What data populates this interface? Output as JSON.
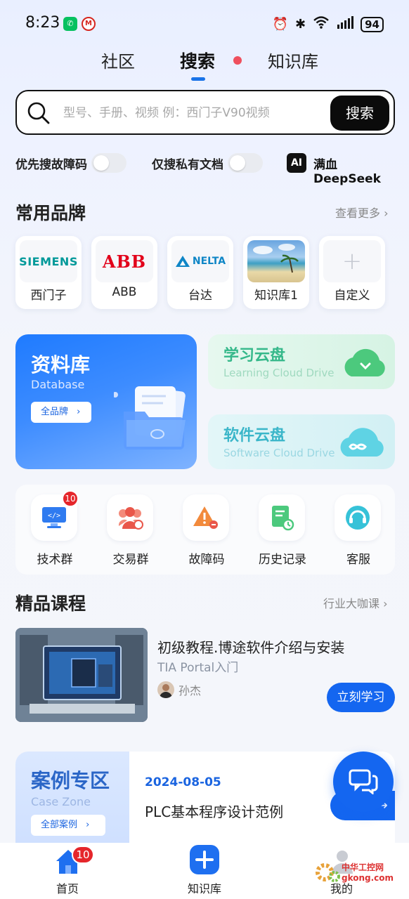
{
  "status_bar": {
    "time": "8:23",
    "battery": "94",
    "icons": [
      "wechat-icon",
      "bank-icon",
      "alarm-icon",
      "bluetooth-icon",
      "wifi-icon",
      "signal-icon",
      "battery-icon"
    ]
  },
  "tabs": [
    {
      "label": "社区",
      "active": false
    },
    {
      "label": "搜索",
      "active": true
    },
    {
      "label": "知识库",
      "active": false
    }
  ],
  "search": {
    "placeholder": "型号、手册、视频 例：西门子V90视频",
    "button_label": "搜索"
  },
  "toggles": {
    "fault_first_label": "优先搜故障码",
    "fault_first_on": false,
    "private_only_label": "仅搜私有文档",
    "private_only_on": false,
    "ai_badge": "AI",
    "ai_label": "满血DeepSeek"
  },
  "brands": {
    "title": "常用品牌",
    "more_label": "查看更多",
    "items": [
      {
        "name": "西门子",
        "logo_text": "SIEMENS"
      },
      {
        "name": "ABB",
        "logo_text": "ABB"
      },
      {
        "name": "台达",
        "logo_text": "NELTA"
      },
      {
        "name": "知识库1",
        "logo_text": ""
      },
      {
        "name": "自定义",
        "logo_text": "+"
      }
    ]
  },
  "database": {
    "title": "资料库",
    "subtitle": "Database",
    "button_label": "全品牌"
  },
  "cloud_learning": {
    "title": "学习云盘",
    "subtitle": "Learning Cloud Drive"
  },
  "cloud_software": {
    "title": "软件云盘",
    "subtitle": "Software Cloud Drive"
  },
  "tools": [
    {
      "label": "技术群",
      "badge": "10"
    },
    {
      "label": "交易群",
      "badge": ""
    },
    {
      "label": "故障码",
      "badge": ""
    },
    {
      "label": "历史记录",
      "badge": ""
    },
    {
      "label": "客服",
      "badge": ""
    }
  ],
  "courses": {
    "title": "精品课程",
    "more_label": "行业大咖课",
    "item": {
      "title": "初级教程.博途软件介绍与安装",
      "subtitle": "TIA Portal入门",
      "author": "孙杰",
      "button_label": "立刻学习"
    }
  },
  "case_zone": {
    "title": "案例专区",
    "subtitle": "Case Zone",
    "button_label": "全部案例",
    "date": "2024-08-05",
    "text": "PLC基本程序设计范例"
  },
  "bottom_nav": [
    {
      "label": "首页",
      "badge": "10"
    },
    {
      "label": "知识库",
      "badge": ""
    },
    {
      "label": "我的",
      "badge": ""
    }
  ],
  "watermark": "中华工控网 gkong.com",
  "colors": {
    "accent": "#1466f0",
    "badge_red": "#e5262b",
    "teal": "#35b88a",
    "cyan": "#3bb6c9"
  }
}
